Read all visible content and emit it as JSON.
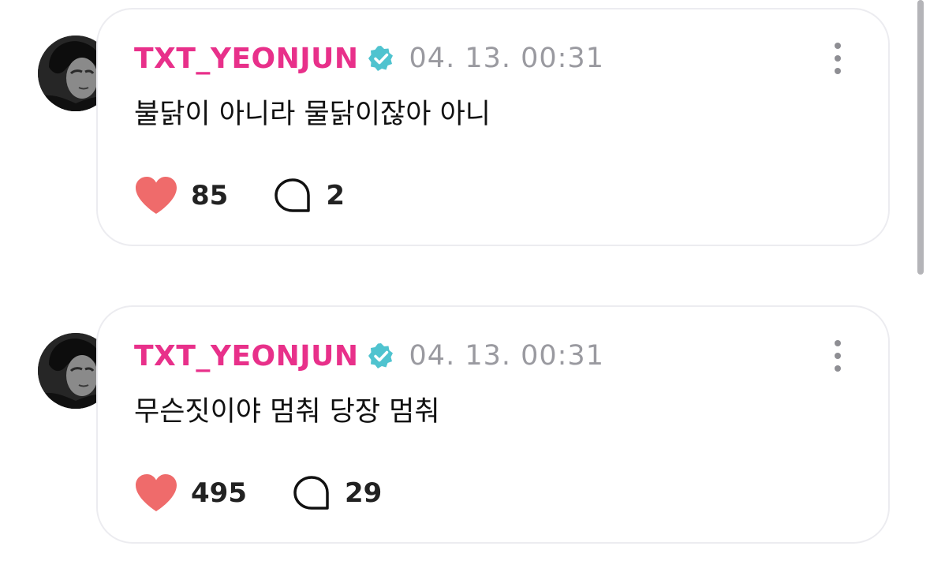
{
  "colors": {
    "username": "#e8308a",
    "verified_badge": "#4fc3cf",
    "heart": "#ef6b6b",
    "timestamp": "#9a9aa0"
  },
  "icons": {
    "verified": "verified-badge-icon",
    "more": "more-vertical-icon",
    "like": "heart-icon",
    "comment": "comment-bubble-icon"
  },
  "posts": [
    {
      "username": "TXT_YEONJUN",
      "timestamp": "04. 13. 00:31",
      "text": "불닭이 아니라 물닭이잖아 아니",
      "likes": "85",
      "comments": "2"
    },
    {
      "username": "TXT_YEONJUN",
      "timestamp": "04. 13. 00:31",
      "text": "무슨짓이야 멈춰 당장 멈춰",
      "likes": "495",
      "comments": "29"
    }
  ]
}
